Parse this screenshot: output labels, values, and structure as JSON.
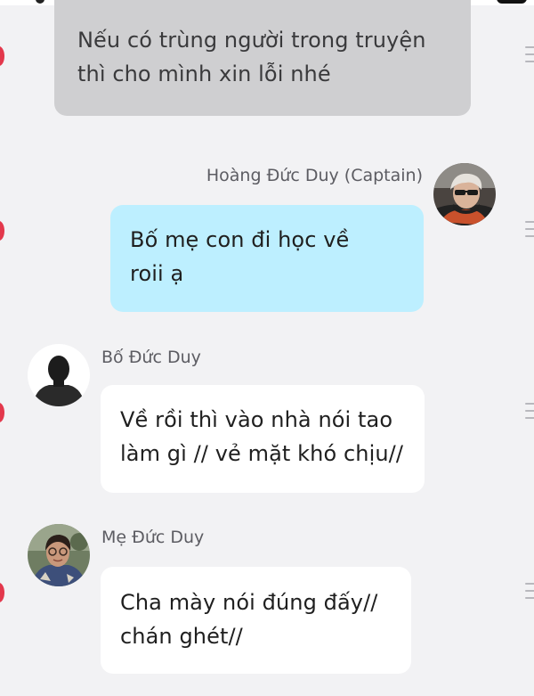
{
  "chat": {
    "messages": [
      {
        "type": "system",
        "line1": "Nếu có trùng người trong truyện",
        "line2": "thì cho mình xin lỗi nhé"
      },
      {
        "sender": "Hoàng Đức Duy (Captain)",
        "side": "right",
        "avatar_icon": "male-avatar-sunglasses",
        "line1": "Bố mẹ con đi học về",
        "line2": "roii ạ"
      },
      {
        "sender": "Bố Đức Duy",
        "side": "left",
        "avatar_icon": "silhouette-avatar",
        "line1": "Về rồi thì vào nhà nói tao",
        "line2": "làm gì // vẻ mặt khó chịu//"
      },
      {
        "sender": "Mẹ Đức Duy",
        "side": "left",
        "avatar_icon": "female-avatar-glasses",
        "line1": "Cha mày nói đúng đấy//",
        "line2": "chán ghét//"
      }
    ]
  },
  "colors": {
    "background": "#f2f2f4",
    "system_bubble": "#cfcfd1",
    "own_bubble": "#bdefff",
    "other_bubble": "#ffffff",
    "unread_marker": "#e3384c"
  }
}
